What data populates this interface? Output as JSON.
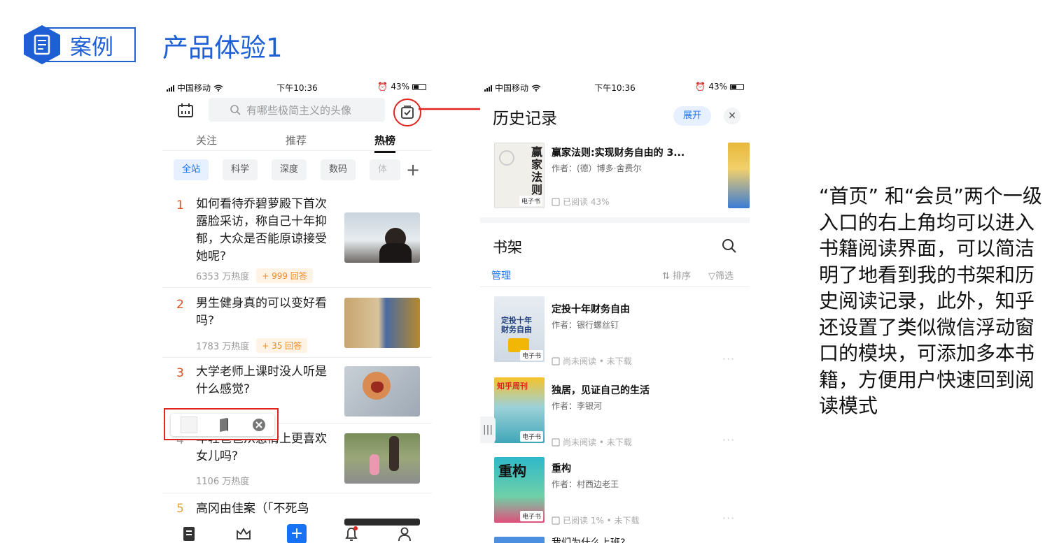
{
  "slide": {
    "badge_label": "案例",
    "title": "产品体验1",
    "accent_color": "#1f5fd6",
    "highlight_color": "#e0251f"
  },
  "left_phone": {
    "status": {
      "carrier": "中国移动",
      "time": "下午10:36",
      "battery": "43%"
    },
    "search": {
      "placeholder": "有哪些极简主义的头像"
    },
    "tabs": [
      "关注",
      "推荐",
      "热榜"
    ],
    "active_tab": "热榜",
    "chips": [
      "全站",
      "科学",
      "深度",
      "数码",
      "体育"
    ],
    "hot_items": [
      {
        "rank": "1",
        "title": "如何看待乔碧萝殿下首次露脸采访，称自己十年抑郁，大众是否能原谅接受她呢?",
        "heat": "6353 万热度",
        "answers": "+ 999 回答"
      },
      {
        "rank": "2",
        "title": "男生健身真的可以变好看吗?",
        "heat": "1783 万热度",
        "answers": "+ 35 回答"
      },
      {
        "rank": "3",
        "title": "大学老师上课时没人听是什么感觉?",
        "heat": "",
        "answers": ""
      },
      {
        "rank": "4",
        "title": "年轻爸爸从感情上更喜欢女儿吗?",
        "heat": "1106 万热度",
        "answers": ""
      },
      {
        "rank": "5",
        "title": "高冈由佳案（「不死鸟",
        "heat": "",
        "answers": ""
      }
    ],
    "bottom_nav": [
      "home-icon",
      "crown-icon",
      "add-icon",
      "bell-icon",
      "profile-icon"
    ]
  },
  "right_phone": {
    "status": {
      "carrier": "中国移动",
      "time": "下午10:36",
      "battery": "43%"
    },
    "history_title": "历史记录",
    "expand_label": "展开",
    "history_book": {
      "title": "赢家法则:实现财务自由的 3...",
      "author": "作者：(德）博多·舍费尔",
      "status": "已阅读 43%",
      "cover_text": "赢家法则",
      "tag": "电子书"
    },
    "shelf_title": "书架",
    "manage_label": "管理",
    "sort_label": "排序",
    "filter_label": "筛选",
    "books": [
      {
        "title": "定投十年财务自由",
        "author": "作者：银行螺丝钉",
        "status": "尚未阅读 • 未下载",
        "tag": "电子书"
      },
      {
        "title": "独居，见证自己的生活",
        "author": "作者：李银河",
        "status": "尚未阅读 • 未下载",
        "tag": "电子书"
      },
      {
        "title": "重构",
        "author": "作者：村西边老王",
        "status": "已阅读 1% • 未下载",
        "tag": "电子书"
      },
      {
        "title": "我们为什么上班?",
        "author": "",
        "status": "",
        "tag": ""
      }
    ],
    "book_covers": [
      "定投十年 财务自由",
      "知乎周刊",
      "重构"
    ]
  },
  "explanation": "“首页” 和“会员”两个一级入口的右上角均可以进入书籍阅读界面，可以简洁明了地看到我的书架和历史阅读记录，此外，知乎还设置了类似微信浮动窗口的模块，可添加多本书籍，方便用户快速回到阅读模式"
}
